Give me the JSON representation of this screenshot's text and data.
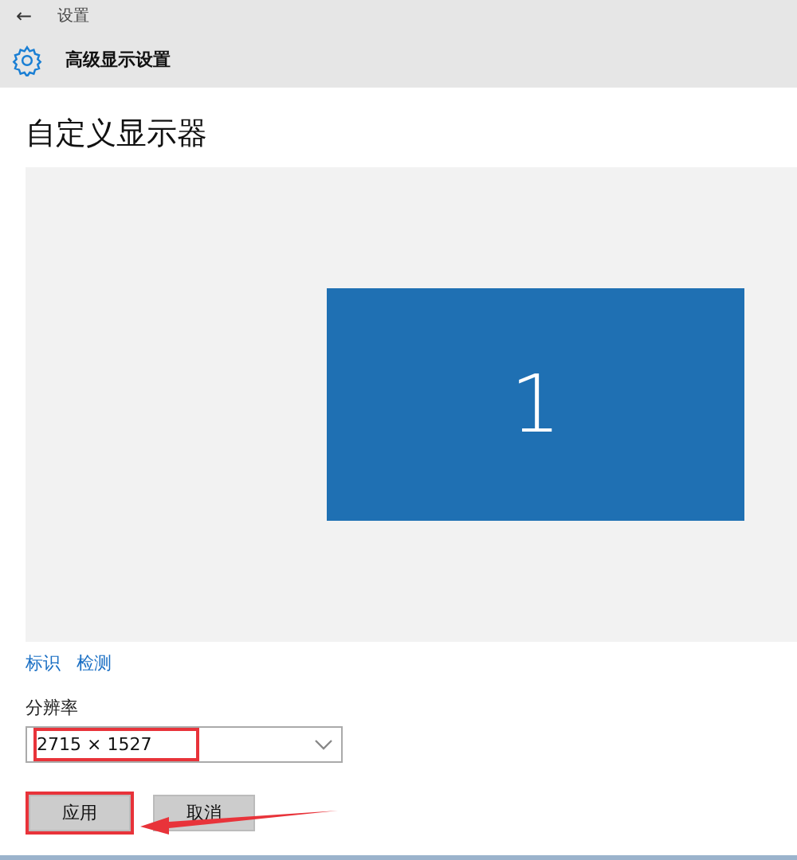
{
  "header": {
    "back": "←",
    "app": "设置",
    "title": "高级显示设置"
  },
  "section_title": "自定义显示器",
  "display": {
    "label": "1",
    "selected": true
  },
  "links": [
    "标识",
    "检测"
  ],
  "resolution": {
    "label": "分辨率",
    "value": "2715 × 1527",
    "highlighted": true
  },
  "buttons": [
    {
      "label": "应用",
      "highlighted": true
    },
    {
      "label": "取消",
      "highlighted": false
    }
  ]
}
